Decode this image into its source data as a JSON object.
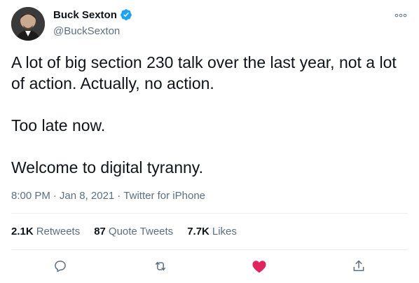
{
  "author": {
    "display_name": "Buck Sexton",
    "handle": "@BuckSexton"
  },
  "tweet": {
    "lines": [
      "A lot of big section 230 talk over the last year, not a lot",
      "of action. Actually, no action.",
      "Too late now.",
      "Welcome to digital tyranny."
    ]
  },
  "meta": {
    "time": "8:00 PM",
    "sep1": "·",
    "date": "Jan 8, 2021",
    "sep2": "·",
    "source": "Twitter for iPhone"
  },
  "stats": {
    "retweets_count": "2.1K",
    "retweets_label": "Retweets",
    "quotes_count": "87",
    "quotes_label": "Quote Tweets",
    "likes_count": "7.7K",
    "likes_label": "Likes"
  },
  "colors": {
    "verified_blue": "#1da1f2",
    "secondary_text": "#5b7083",
    "like_red": "#e0245e",
    "divider": "#ebeef0"
  },
  "icons": [
    "verified-icon",
    "more-icon",
    "reply-icon",
    "retweet-icon",
    "like-icon",
    "share-icon"
  ]
}
